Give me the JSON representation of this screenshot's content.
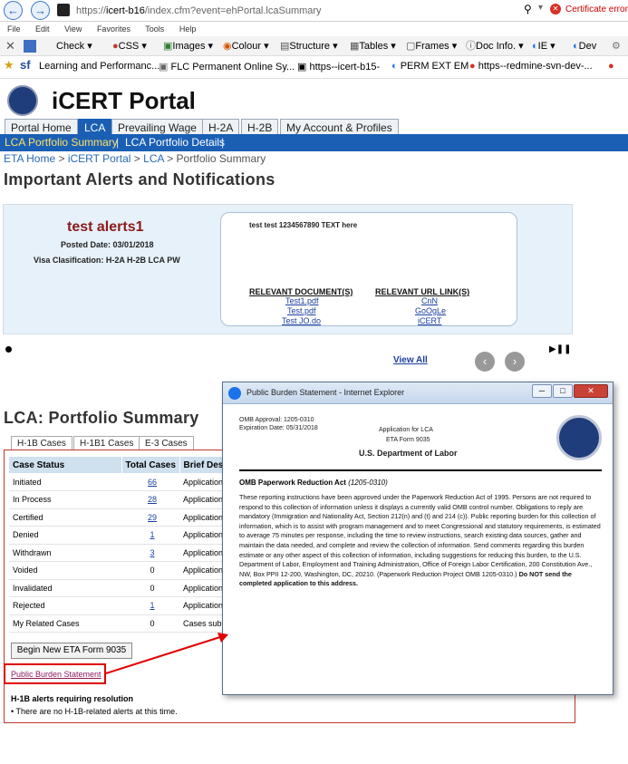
{
  "browser": {
    "url_prefix": "https://",
    "url_host": "icert-b16",
    "url_path": "/index.cfm?event=ehPortal.lcaSummary",
    "cert_error": "Certificate error",
    "menu": [
      "File",
      "Edit",
      "View",
      "Favorites",
      "Tools",
      "Help"
    ],
    "toolbar": [
      "Check",
      "CSS",
      "Images",
      "Colour",
      "Structure",
      "Tables",
      "Frames",
      "Doc Info.",
      "IE",
      "Dev"
    ],
    "favorites": [
      "Learning and Performanc...",
      "FLC  Permanent Online Sy...",
      "https--icert-b15-",
      "PERM EXT EM",
      "https--redmine-svn-dev-..."
    ]
  },
  "portal": {
    "title": "iCERT Portal",
    "tabs": [
      "Portal Home",
      "LCA",
      "Prevailing Wage",
      "H-2A",
      "H-2B",
      "My Account & Profiles"
    ],
    "subnav": [
      "LCA Portfolio Summary",
      "LCA Portfolio Details"
    ],
    "breadcrumb": [
      "ETA Home",
      "iCERT Portal",
      "LCA",
      "Portfolio Summary"
    ],
    "crumb_sep": ">"
  },
  "alerts": {
    "heading": "Important Alerts and Notifications",
    "name": "test alerts1",
    "posted": "Posted Date: 03/01/2018",
    "visa": "Visa Clasification: H-2A H-2B LCA PW",
    "text": "test test 1234567890 TEXT here",
    "docs_heading": "RELEVANT DOCUMENT(S)",
    "docs": [
      "Test1.pdf",
      "Test.pdf",
      "Test JO.do"
    ],
    "urls_heading": "RELEVANT URL LINK(S)",
    "urls": [
      "CnN",
      "GoOgLe",
      "iCERT"
    ],
    "view_all": "View All"
  },
  "lca": {
    "heading": "LCA: Portfolio Summary",
    "tabs": [
      "H-1B Cases",
      "H-1B1 Cases",
      "E-3 Cases"
    ],
    "columns": [
      "Case Status",
      "Total Cases",
      "Brief Desc"
    ],
    "rows": [
      {
        "status": "Initiated",
        "total": "66",
        "desc": "Application"
      },
      {
        "status": "In Process",
        "total": "28",
        "desc": "Application"
      },
      {
        "status": "Certified",
        "total": "29",
        "desc": "Application"
      },
      {
        "status": "Denied",
        "total": "1",
        "desc": "Application"
      },
      {
        "status": "Withdrawn",
        "total": "3",
        "desc": "Application"
      },
      {
        "status": "Voided",
        "total": "0",
        "desc": "Application"
      },
      {
        "status": "Invalidated",
        "total": "0",
        "desc": "Application"
      },
      {
        "status": "Rejected",
        "total": "1",
        "desc": "Application"
      },
      {
        "status": "My Related Cases",
        "total": "0",
        "desc": "Cases subr"
      }
    ],
    "begin_button": "Begin New ETA Form 9035",
    "pbs_link": "Public Burden Statement",
    "resolve_heading": "H-1B alerts requiring resolution",
    "resolve_item": "There are no H-1B-related alerts at this time."
  },
  "popup": {
    "title": "Public Burden Statement - Internet Explorer",
    "omb_approval": "OMB Approval: 1205-0310",
    "expiration": "Expiration Date: 05/31/2018",
    "app_line1": "Application for LCA",
    "app_line2": "ETA Form 9035",
    "dept": "U.S. Department of Labor",
    "act_heading": "OMB Paperwork Reduction Act",
    "act_number": "(1205-0310)",
    "act_text": "These reporting instructions have been approved under the Paperwork Reduction Act of 1995. Persons are not required to respond to this collection of information unless it displays a currently valid OMB control number. Obligations to reply are mandatory (Immigration and Nationality Act, Section 212(n) and (t) and 214 (c)). Public reporting burden for this collection of information, which is to assist with program management and to meet Congressional and statutory requirements, is estimated to average 75 minutes per response, including the time to review instructions, search existing data sources, gather and maintain the data needed, and complete and review the collection of information. Send comments regarding this burden estimate or any other aspect of this collection of information, including suggestions for reducing this burden, to the U.S. Department of Labor, Employment and Training Administration, Office of Foreign Labor Certification, 200 Constitution Ave., NW, Box PPII 12-200, Washington, DC, 20210. (Paperwork Reduction Project OMB 1205-0310.)",
    "act_bold": "Do NOT send the completed application to this address."
  },
  "colors": {
    "portal_blue": "#1a5fb4",
    "alert_red": "#8b1a1a",
    "highlight_red": "#e00000"
  }
}
